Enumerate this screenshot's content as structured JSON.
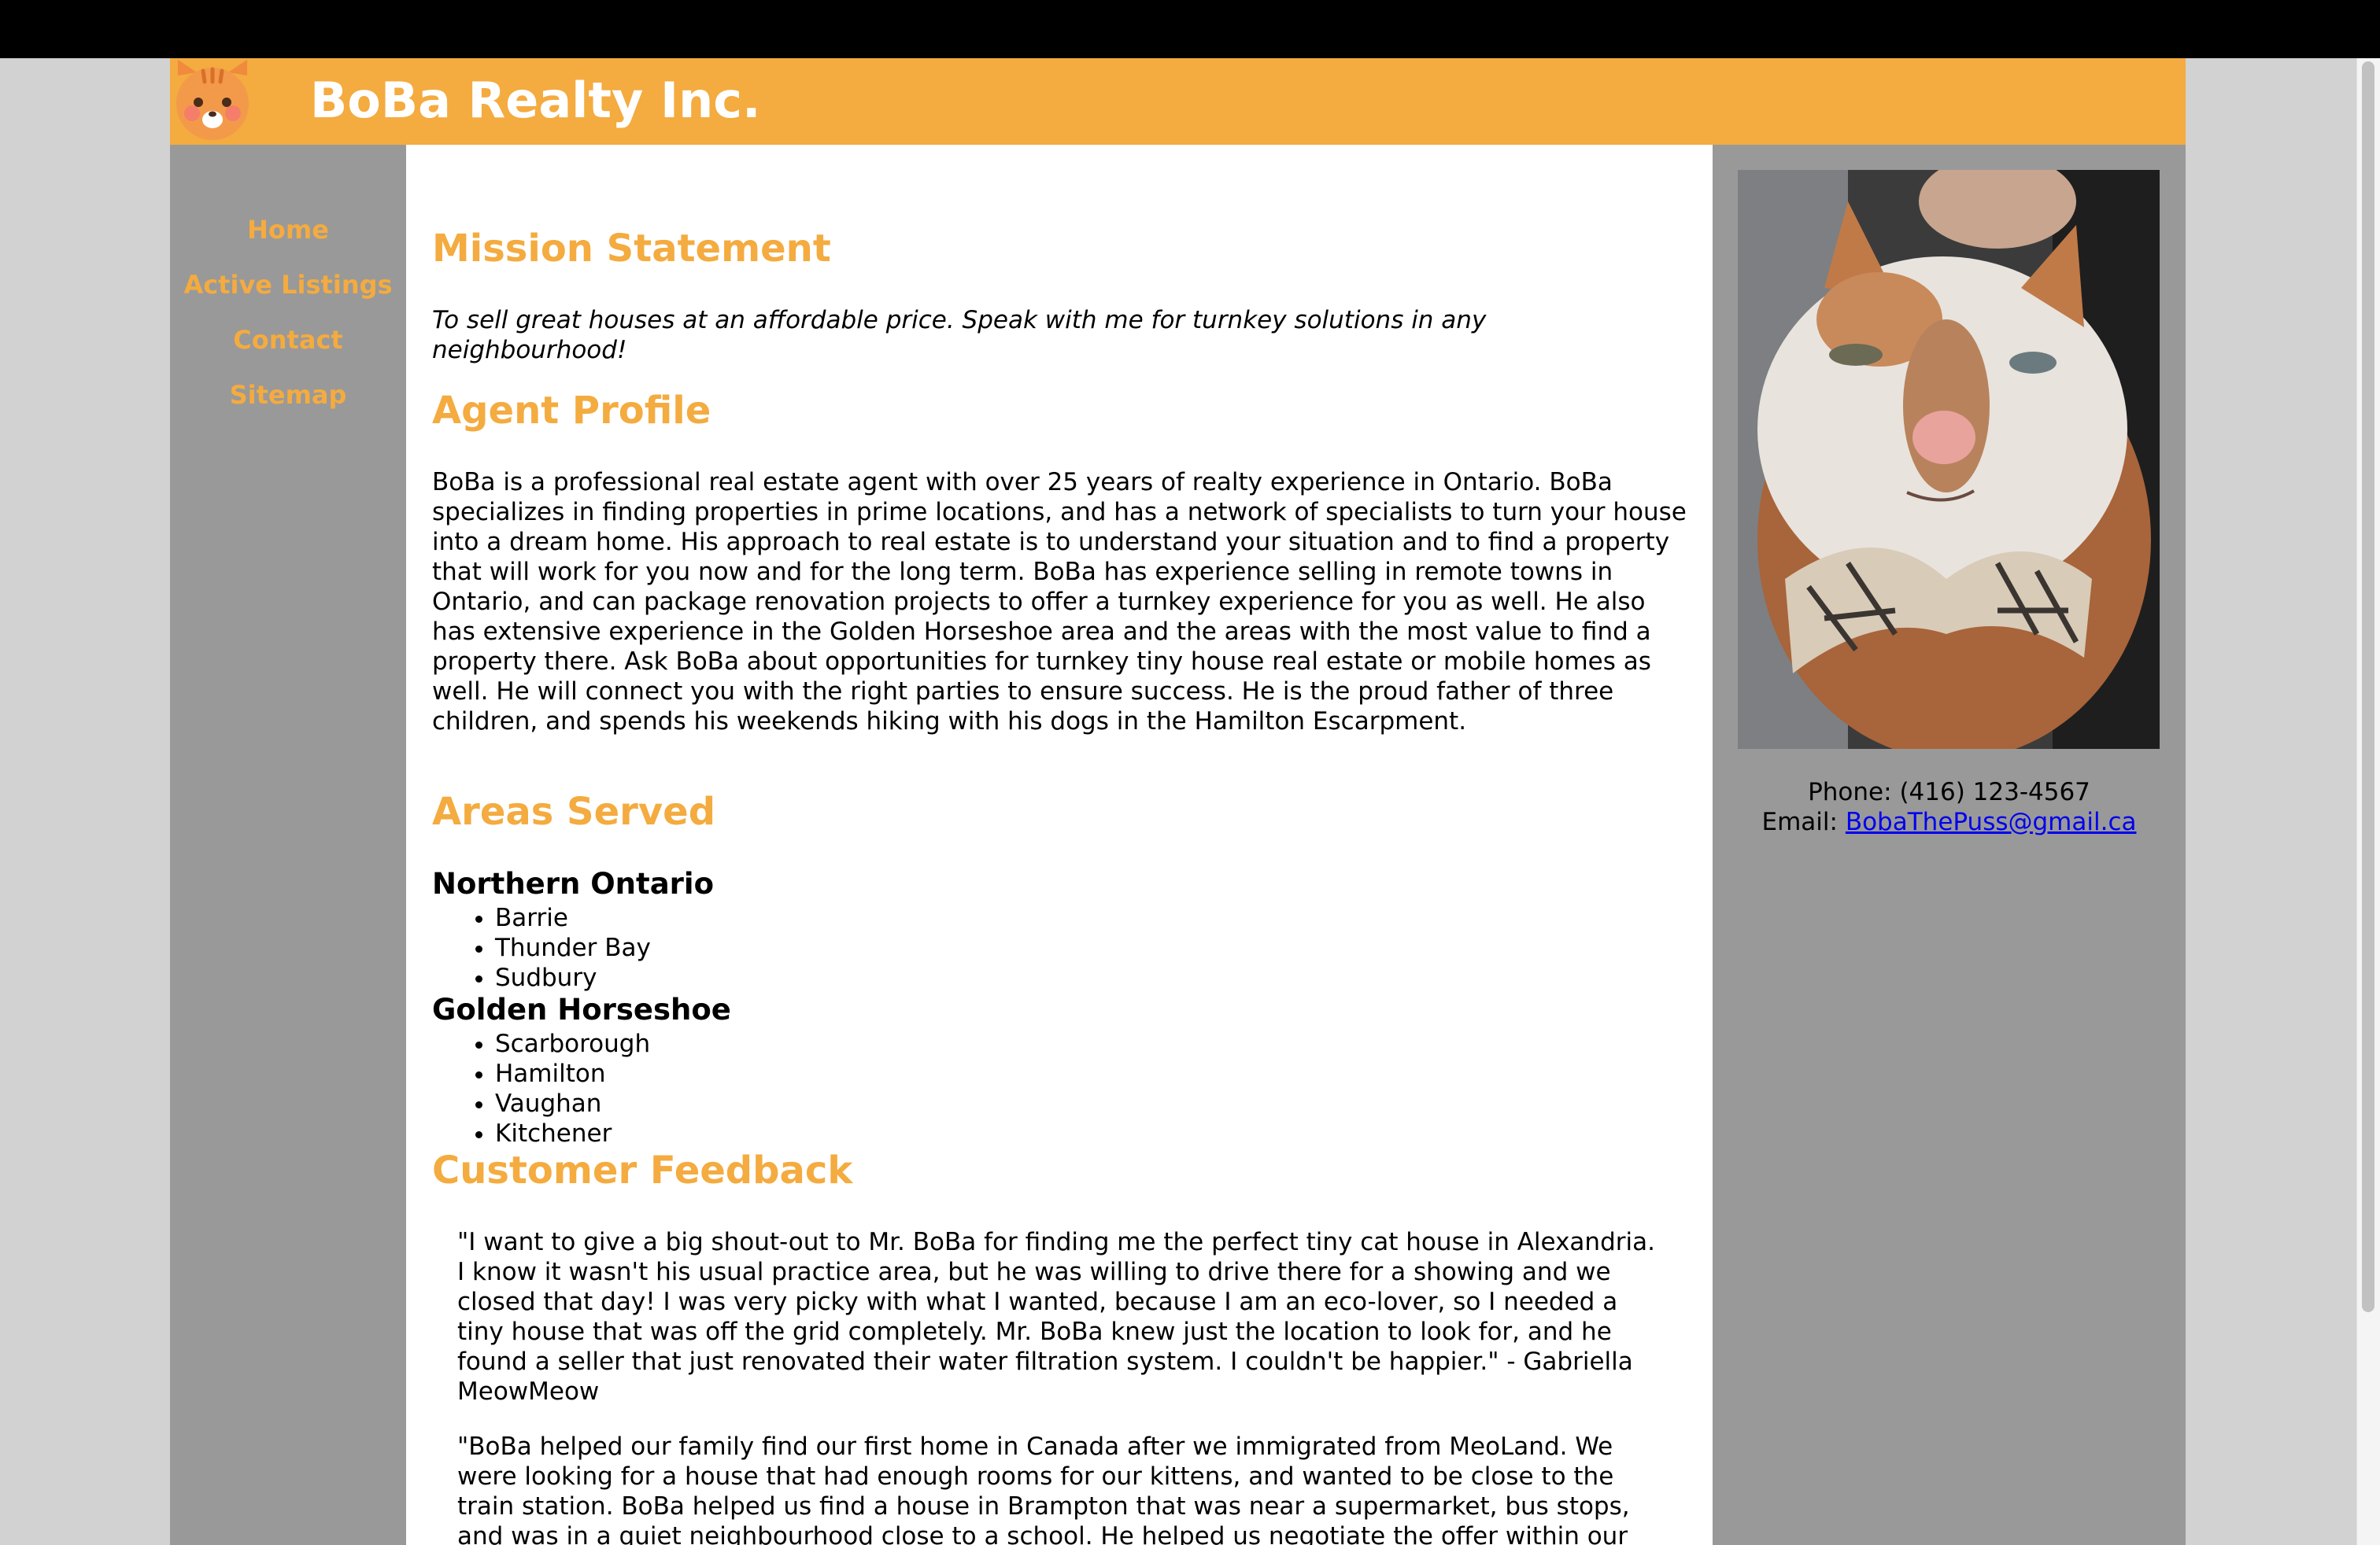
{
  "header": {
    "title": "BoBa Realty Inc.",
    "logo_icon": "orange-cat-face-icon",
    "background_color": "#f4ab3f"
  },
  "nav": {
    "items": [
      {
        "label": "Home"
      },
      {
        "label": "Active Listings"
      },
      {
        "label": "Contact"
      },
      {
        "label": "Sitemap"
      }
    ],
    "link_color": "#f4ab3f"
  },
  "main": {
    "mission": {
      "heading": "Mission Statement",
      "text": "To sell great houses at an affordable price. Speak with me for turnkey solutions in any neighbourhood!"
    },
    "profile": {
      "heading": "Agent Profile",
      "text": "BoBa is a professional real estate agent with over 25 years of realty experience in Ontario. BoBa specializes in finding properties in prime locations, and has a network of specialists to turn your house into a dream home. His approach to real estate is to understand your situation and to find a property that will work for you now and for the long term. BoBa has experience selling in remote towns in Ontario, and can package renovation projects to offer a turnkey experience for you as well. He also has extensive experience in the Golden Horseshoe area and the areas with the most value to find a property there. Ask BoBa about opportunities for turnkey tiny house real estate or mobile homes as well. He will connect you with the right parties to ensure success. He is the proud father of three children, and spends his weekends hiking with his dogs in the Hamilton Escarpment."
    },
    "areas": {
      "heading": "Areas Served",
      "regions": [
        {
          "name": "Northern Ontario",
          "cities": [
            "Barrie",
            "Thunder Bay",
            "Sudbury"
          ]
        },
        {
          "name": "Golden Horseshoe",
          "cities": [
            "Scarborough",
            "Hamilton",
            "Vaughan",
            "Kitchener"
          ]
        }
      ]
    },
    "feedback": {
      "heading": "Customer Feedback",
      "quotes": [
        "\"I want to give a big shout-out to Mr. BoBa for finding me the perfect tiny cat house in Alexandria. I know it wasn't his usual practice area, but he was willing to drive there for a showing and we closed that day! I was very picky with what I wanted, because I am an eco-lover, so I needed a tiny house that was off the grid completely. Mr. BoBa knew just the location to look for, and he found a seller that just renovated their water filtration system. I couldn't be happier.\" - Gabriella MeowMeow",
        "\"BoBa helped our family find our first home in Canada after we immigrated from MeoLand. We were looking for a house that had enough rooms for our kittens, and wanted to be close to the train station. BoBa helped us find a house in Brampton that was near a supermarket, bus stops, and was in a quiet neighbourhood close to a school. He helped us negotiate the offer within our price range, and helped with the paperwork involved to buy a house in Canada. I am happy to live here thanks to BoBa.\" - Kiran Sausage"
      ]
    }
  },
  "sidebar": {
    "photo_icon": "cat-with-bow-tie-photo",
    "phone_label": "Phone:",
    "phone": "(416) 123-4567",
    "email_label": "Email:",
    "email": "BobaThePuss@gmail.ca"
  }
}
